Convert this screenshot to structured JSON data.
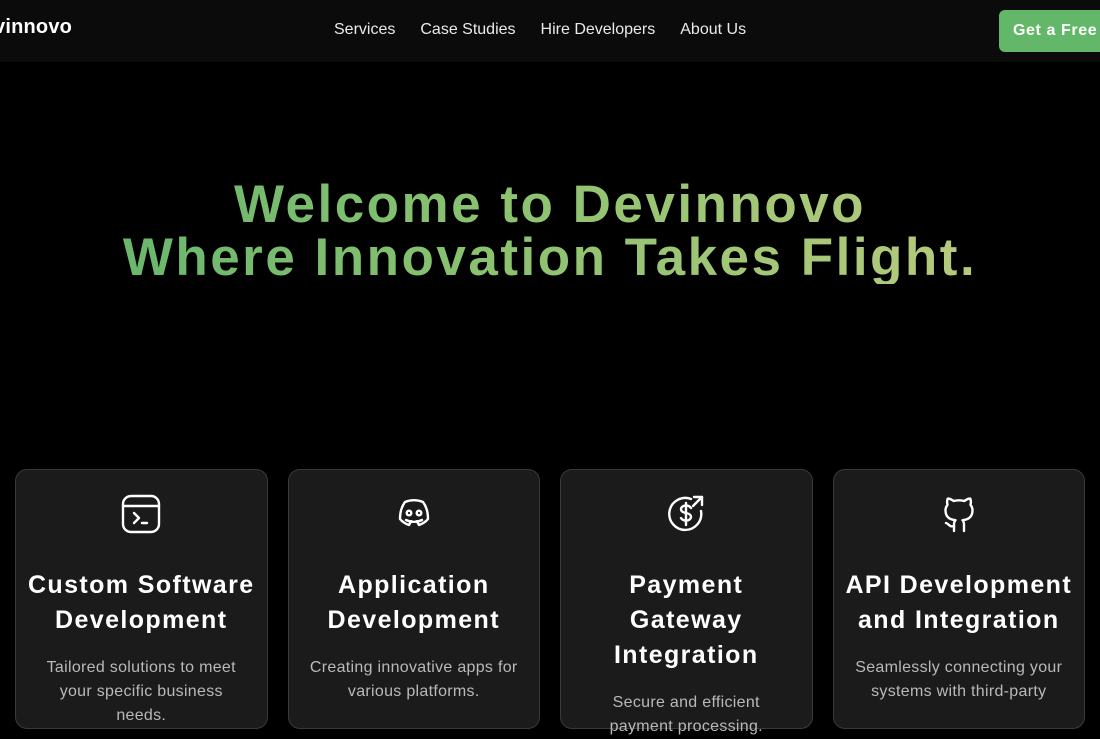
{
  "header": {
    "logo_text": "vinnovo",
    "nav": [
      {
        "label": "Services"
      },
      {
        "label": "Case Studies"
      },
      {
        "label": "Hire Developers"
      },
      {
        "label": "About Us"
      }
    ],
    "cta_label": "Get a Free Q"
  },
  "hero": {
    "line1": "Welcome to Devinnovo",
    "line2": "Where Innovation Takes Flight."
  },
  "colors": {
    "accent": "#62b868",
    "background": "#000000",
    "card_background": "#1b1b1b"
  },
  "cards": [
    {
      "icon": "terminal-window-icon",
      "title": "Custom Software Development",
      "desc": "Tailored solutions to meet your specific business needs."
    },
    {
      "icon": "discord-icon",
      "title": "Application Development",
      "desc": "Creating innovative apps for various platforms."
    },
    {
      "icon": "dollar-circle-icon",
      "title": "Payment Gateway Integration",
      "desc": "Secure and efficient payment processing."
    },
    {
      "icon": "github-icon",
      "title": "API Development and Integration",
      "desc": "Seamlessly connecting your systems with third-party"
    }
  ]
}
